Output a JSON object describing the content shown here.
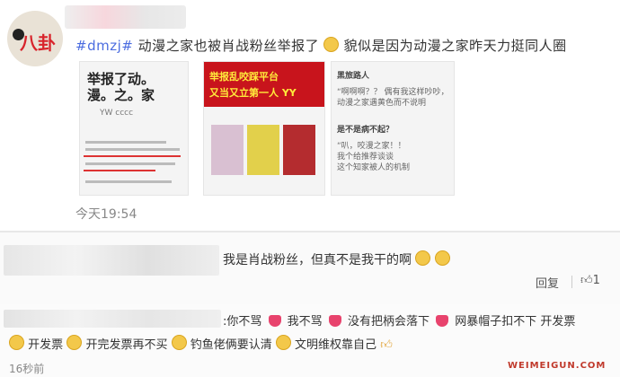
{
  "post": {
    "avatar_text": "八卦",
    "hashtag": "#dmzj#",
    "text": " 动漫之家也被肖战粉丝举报了",
    "text2": " 貌似是因为动漫之家昨天力挺同人圈",
    "time": "今天19:54",
    "thumb1": {
      "headline": "举报了动。漫。之。家",
      "user": "YW cccc"
    },
    "thumb2": {
      "banner1": "举报乱咬踩平台",
      "banner2": "又当又立第一人 YY"
    },
    "thumb3": {
      "lines": [
        "黑旅路人",
        "“啊啊啊？？ 偶有我这样吵吵，",
        "动漫之家遇黄色而不说明",
        "是不是病不起？",
        "“叭，咬漫之家！！",
        "我个给推荐谈谈",
        "这个知家被人的机制"
      ]
    }
  },
  "comments": [
    {
      "text": "我是肖战粉丝，但真不是我干的啊",
      "reply_label": "回复",
      "like_count": "1"
    },
    {
      "line1": ":你不骂",
      "line1b": "我不骂",
      "line1c": "没有把柄会落下",
      "line1d": "网暴帽子扣不下 开发票",
      "line2a": "开发票",
      "line2b": "开完发票再不买",
      "line2c": "钓鱼佬俩要认清",
      "line2d": "文明维权靠自己",
      "time": "16秒前"
    }
  ],
  "watermark": "WEIMEIGUN.COM"
}
